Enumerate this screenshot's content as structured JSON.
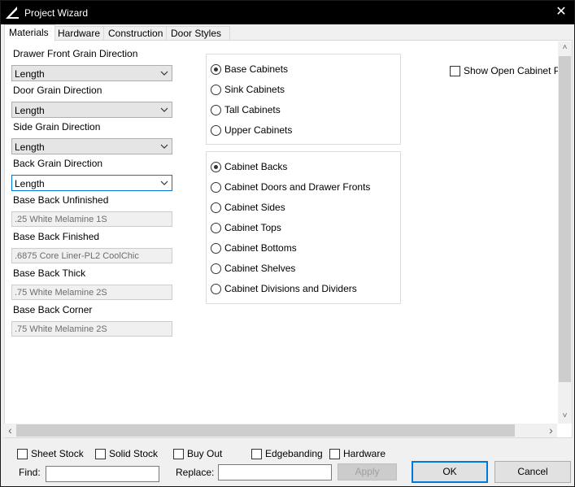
{
  "window": {
    "title": "Project Wizard",
    "close_glyph": "✕",
    "icon": "triangle-logo-icon"
  },
  "tabs": [
    {
      "label": "Materials",
      "active": true
    },
    {
      "label": "Hardware",
      "active": false
    },
    {
      "label": "Construction",
      "active": false
    },
    {
      "label": "Door Styles",
      "active": false
    }
  ],
  "materials": {
    "drawer_front_grain": {
      "label": "Drawer Front Grain Direction",
      "value": "Length"
    },
    "door_grain": {
      "label": "Door Grain Direction",
      "value": "Length"
    },
    "side_grain": {
      "label": "Side Grain Direction",
      "value": "Length"
    },
    "back_grain": {
      "label": "Back Grain Direction",
      "value": "Length"
    },
    "base_back_unfinished": {
      "label": "Base Back Unfinished",
      "value": ".25 White Melamine 1S"
    },
    "base_back_finished": {
      "label": "Base Back Finished",
      "value": ".6875 Core Liner-PL2 CoolChic"
    },
    "base_back_thick": {
      "label": "Base Back Thick",
      "value": ".75 White Melamine 2S"
    },
    "base_back_corner": {
      "label": "Base Back Corner",
      "value": ".75 White Melamine 2S"
    }
  },
  "cabinet_types": {
    "selected": "Base Cabinets",
    "options": [
      "Base Cabinets",
      "Sink Cabinets",
      "Tall Cabinets",
      "Upper Cabinets"
    ]
  },
  "cabinet_parts": {
    "selected": "Cabinet Backs",
    "options": [
      "Cabinet Backs",
      "Cabinet Doors and Drawer Fronts",
      "Cabinet Sides",
      "Cabinet Tops",
      "Cabinet Bottoms",
      "Cabinet Shelves",
      "Cabinet Divisions and Dividers"
    ]
  },
  "show_open": {
    "label": "Show Open Cabinet Par",
    "checked": false
  },
  "filters": [
    {
      "label": "Sheet Stock",
      "checked": false
    },
    {
      "label": "Solid Stock",
      "checked": false
    },
    {
      "label": "Buy Out",
      "checked": false
    },
    {
      "label": "Edgebanding",
      "checked": false
    },
    {
      "label": "Hardware",
      "checked": false
    }
  ],
  "find": {
    "label": "Find:",
    "value": ""
  },
  "replace": {
    "label": "Replace:",
    "value": ""
  },
  "buttons": {
    "apply": "Apply",
    "ok": "OK",
    "cancel": "Cancel"
  },
  "scroll_glyphs": {
    "up": "˄",
    "down": "˅",
    "left": "‹",
    "right": "›"
  }
}
